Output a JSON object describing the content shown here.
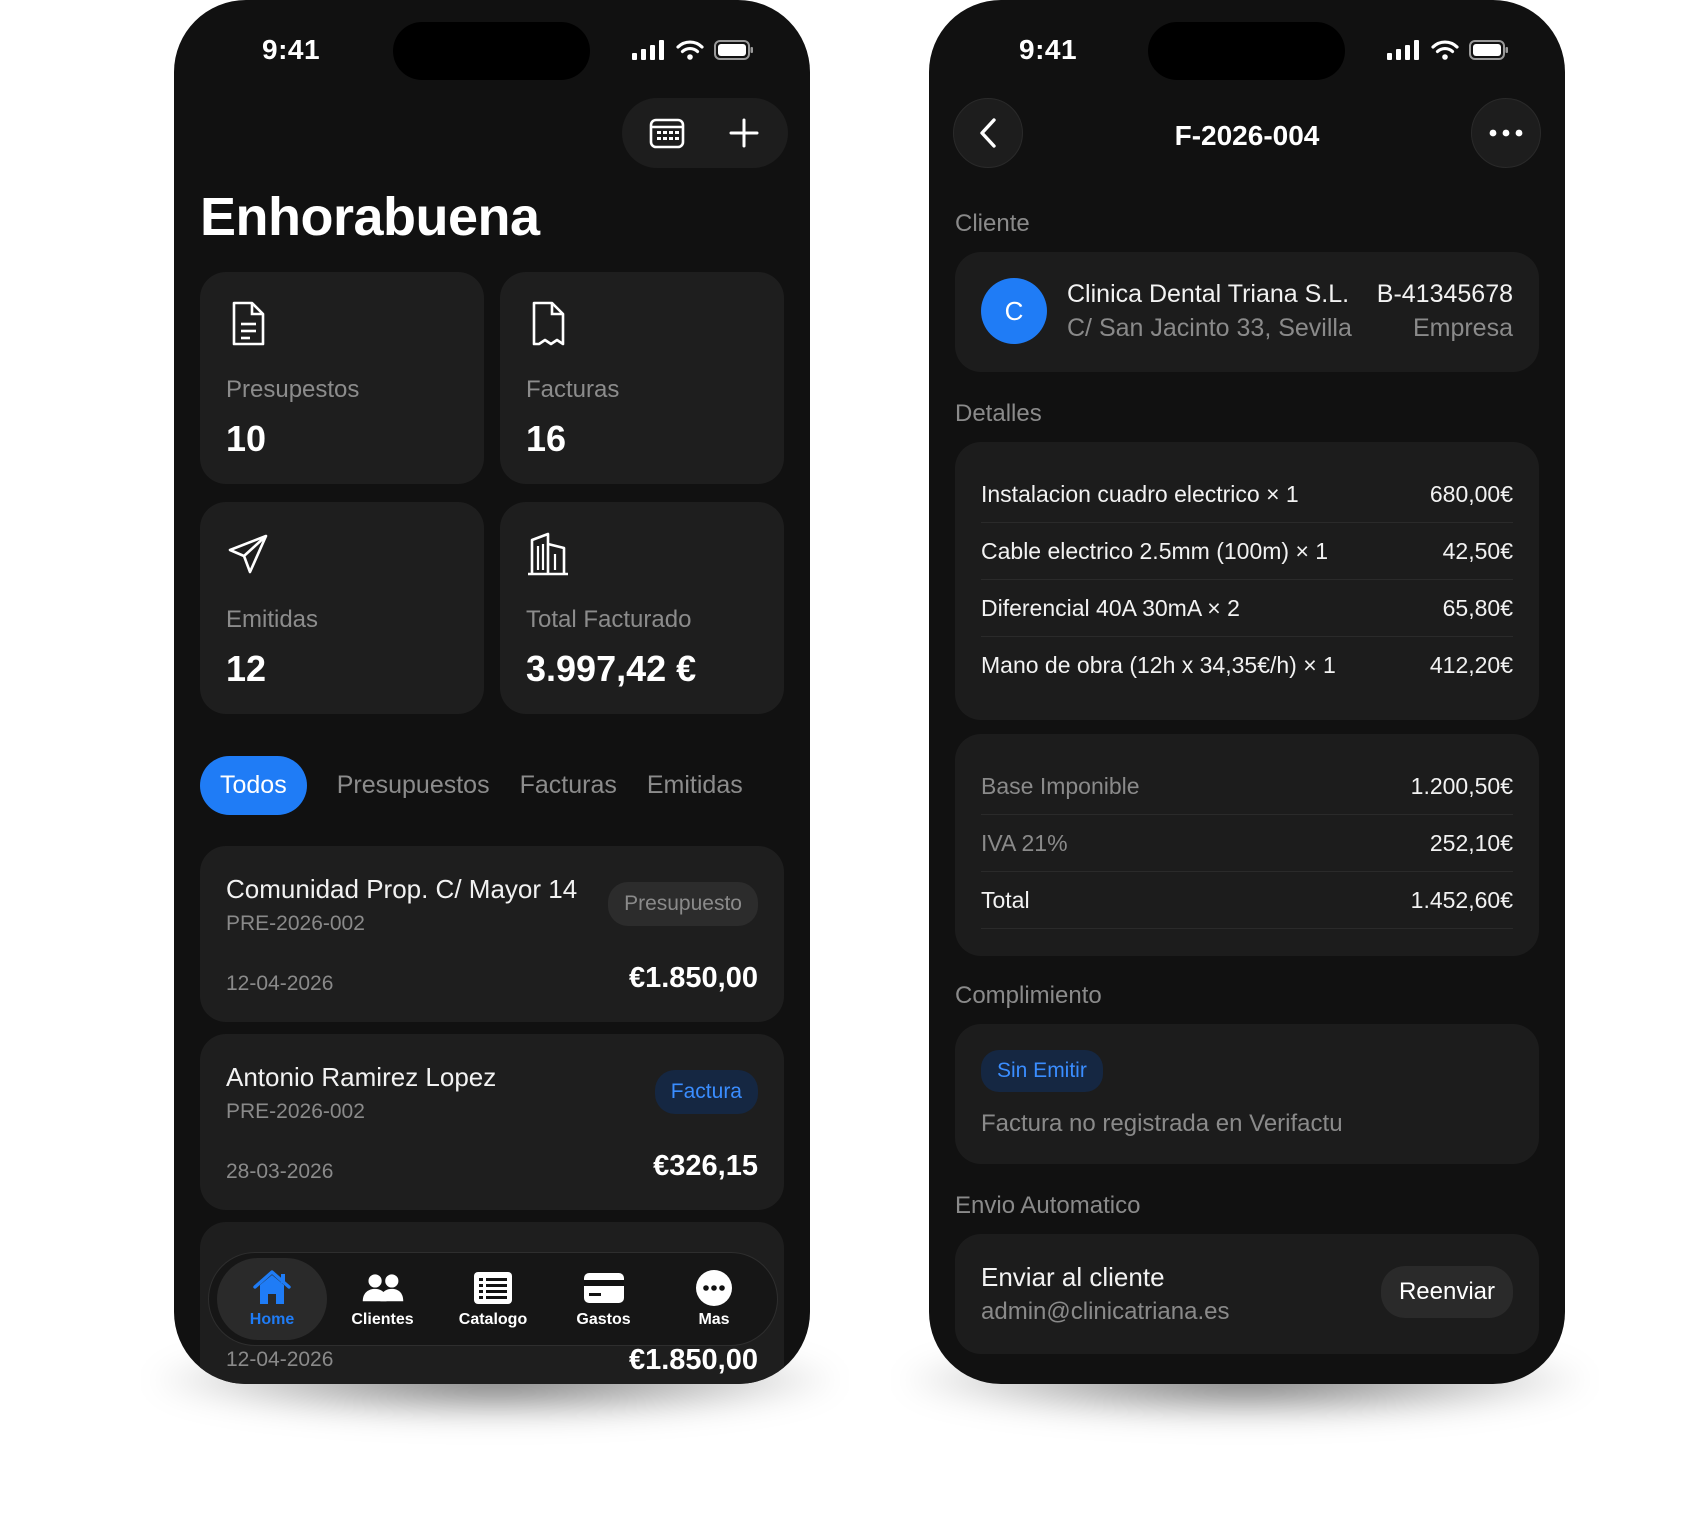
{
  "status_bar": {
    "time": "9:41"
  },
  "home": {
    "greeting": "Enhorabuena",
    "toolbar": {
      "calendar_icon": "calendar-icon",
      "add_icon": "plus-icon"
    },
    "stats": [
      {
        "label": "Presupestos",
        "value": "10",
        "icon": "document-text-icon"
      },
      {
        "label": "Facturas",
        "value": "16",
        "icon": "document-icon"
      },
      {
        "label": "Emitidas",
        "value": "12",
        "icon": "paper-plane-icon"
      },
      {
        "label": "Total Facturado",
        "value": "3.997,42 €",
        "icon": "building-icon"
      }
    ],
    "filters": [
      "Todos",
      "Presupuestos",
      "Facturas",
      "Emitidas"
    ],
    "active_filter": "Todos",
    "documents": [
      {
        "client": "Comunidad Prop. C/ Mayor 14",
        "ref": "PRE-2026-002",
        "date": "12-04-2026",
        "amount": "€1.850,00",
        "badge": "Presupuesto",
        "badge_color": "#8a8a8a"
      },
      {
        "client": "Antonio Ramirez Lopez",
        "ref": "PRE-2026-002",
        "date": "28-03-2026",
        "amount": "€326,15",
        "badge": "Factura",
        "badge_color": "#3a8dff"
      },
      {
        "date": "12-04-2026",
        "amount": "€1.850,00"
      }
    ],
    "tabbar": [
      {
        "label": "Home",
        "icon": "house-icon",
        "active": true
      },
      {
        "label": "Clientes",
        "icon": "users-icon",
        "active": false
      },
      {
        "label": "Catalogo",
        "icon": "list-icon",
        "active": false
      },
      {
        "label": "Gastos",
        "icon": "credit-card-icon",
        "active": false
      },
      {
        "label": "Mas",
        "icon": "more-icon",
        "active": false
      }
    ]
  },
  "invoice": {
    "title": "F-2026-004",
    "cliente_label": "Cliente",
    "client": {
      "initial": "C",
      "name": "Clinica Dental Triana S.L.",
      "address": "C/ San Jacinto 33, Sevilla",
      "nif": "B-41345678",
      "type": "Empresa"
    },
    "detalles_label": "Detalles",
    "lines": [
      {
        "desc": "Instalacion cuadro electrico × 1",
        "amount": "680,00€"
      },
      {
        "desc": "Cable electrico 2.5mm (100m) × 1",
        "amount": "42,50€"
      },
      {
        "desc": "Diferencial 40A 30mA × 2",
        "amount": "65,80€"
      },
      {
        "desc": "Mano de obra (12h x 34,35€/h) × 1",
        "amount": "412,20€"
      }
    ],
    "totals": [
      {
        "label": "Base Imponible",
        "amount": "1.200,50€"
      },
      {
        "label": "IVA 21%",
        "amount": "252,10€"
      },
      {
        "label": "Total",
        "amount": "1.452,60€"
      }
    ],
    "compliance_label": "Complimiento",
    "compliance": {
      "status": "Sin Emitir",
      "description": "Factura no registrada en Verifactu"
    },
    "envio_label": "Envio Automatico",
    "envio": {
      "title": "Enviar al cliente",
      "email": "admin@clinicatriana.es",
      "button": "Reenviar"
    }
  },
  "colors": {
    "accent": "#1f7cf6",
    "background": "#111111",
    "card": "#1e1e1e",
    "muted_text": "#8a8a8a"
  }
}
